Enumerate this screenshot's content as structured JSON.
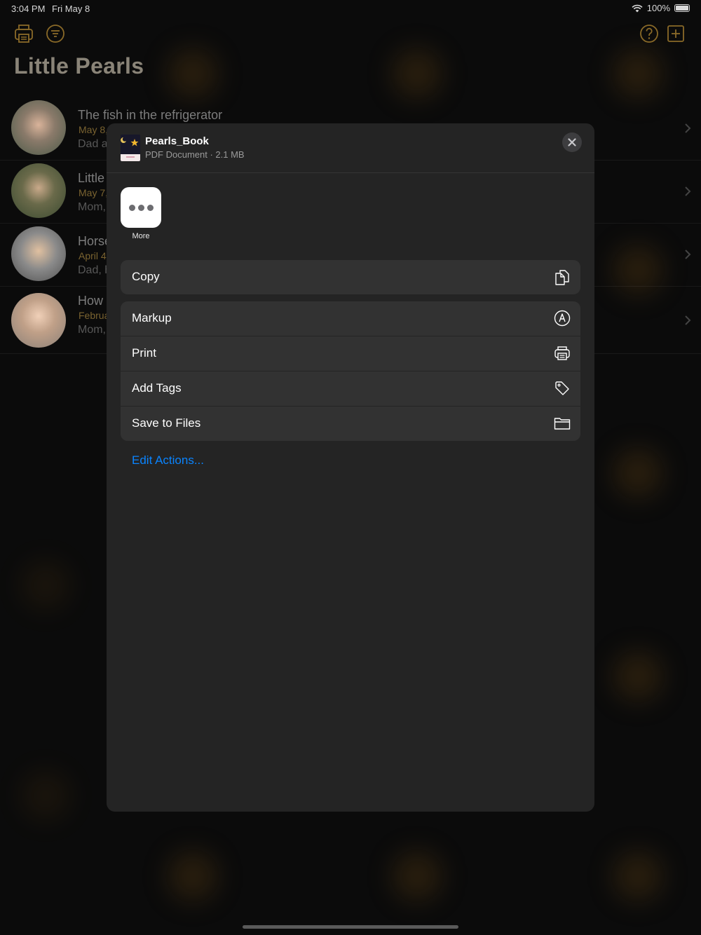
{
  "status_bar": {
    "time": "3:04 PM",
    "date": "Fri May 8",
    "battery": "100%",
    "battery_level": 1.0
  },
  "app": {
    "title": "Little Pearls"
  },
  "toolbar_icons": [
    "printer-icon",
    "filter-icon",
    "help-icon",
    "add-icon"
  ],
  "list": [
    {
      "title": "The fish in the refrigerator",
      "date": "May 8,",
      "subtitle": "Dad a"
    },
    {
      "title": "Little",
      "date": "May 7,",
      "subtitle": "Mom,"
    },
    {
      "title": "Horse",
      "date": "April 4",
      "subtitle": "Dad, h"
    },
    {
      "title": "How c",
      "date": "Februa",
      "subtitle": "Mom,"
    }
  ],
  "share_sheet": {
    "file_name": "Pearls_Book",
    "file_meta": "PDF Document · 2.1 MB",
    "more_label": "More",
    "copy_label": "Copy",
    "actions": [
      {
        "label": "Markup",
        "icon": "markup-icon"
      },
      {
        "label": "Print",
        "icon": "printer-icon"
      },
      {
        "label": "Add Tags",
        "icon": "tag-icon"
      },
      {
        "label": "Save to Files",
        "icon": "folder-icon"
      }
    ],
    "edit_actions": "Edit Actions..."
  },
  "colors": {
    "accent": "#0a84ff",
    "gold": "#a07c2e",
    "sheet_bg": "#242424",
    "row_bg": "#323232"
  }
}
